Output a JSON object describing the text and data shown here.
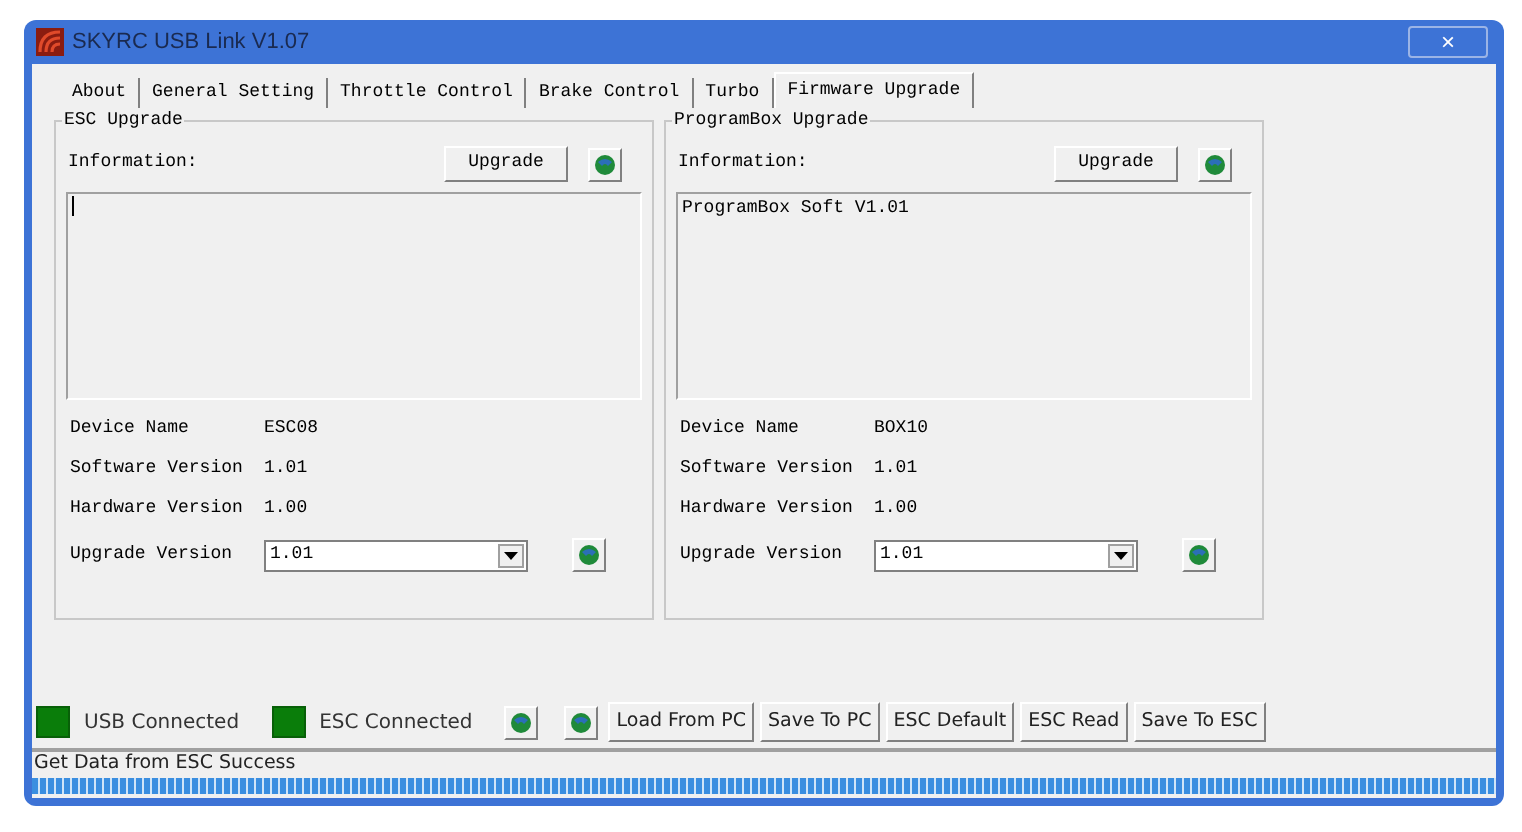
{
  "window": {
    "title": "SKYRC USB Link V1.07",
    "close": "×"
  },
  "tabs": [
    {
      "label": "About",
      "selected": false
    },
    {
      "label": "General Setting",
      "selected": false
    },
    {
      "label": "Throttle Control",
      "selected": false
    },
    {
      "label": "Brake Control",
      "selected": false
    },
    {
      "label": "Turbo",
      "selected": false
    },
    {
      "label": "Firmware Upgrade",
      "selected": true
    }
  ],
  "panels": [
    {
      "title": "ESC Upgrade",
      "info_label": "Information:",
      "upgrade_button": "Upgrade",
      "fields": [
        {
          "label": "Device Name",
          "value": "ESC08"
        },
        {
          "label": "Software Version",
          "value": "1.01"
        },
        {
          "label": "Hardware Version",
          "value": "1.00"
        }
      ],
      "upgrade_version": {
        "label": "Upgrade Version",
        "value": "1.01"
      }
    },
    {
      "title": "ProgramBox Upgrade",
      "info_label": "Information:",
      "upgrade_button": "Upgrade",
      "info_text": "ProgramBox Soft V1.01",
      "fields": [
        {
          "label": "Device Name",
          "value": "BOX10"
        },
        {
          "label": "Software Version",
          "value": "1.01"
        },
        {
          "label": "Hardware Version",
          "value": "1.00"
        }
      ],
      "upgrade_version": {
        "label": "Upgrade Version",
        "value": "1.01"
      }
    }
  ],
  "indicators": [
    {
      "label": "USB Connected",
      "on": true
    },
    {
      "label": "ESC Connected",
      "on": true
    }
  ],
  "buttons": [
    "Load From PC",
    "Save To PC",
    "ESC Default",
    "ESC Read",
    "Save To ESC"
  ],
  "status_bar": "Get Data from ESC Success"
}
